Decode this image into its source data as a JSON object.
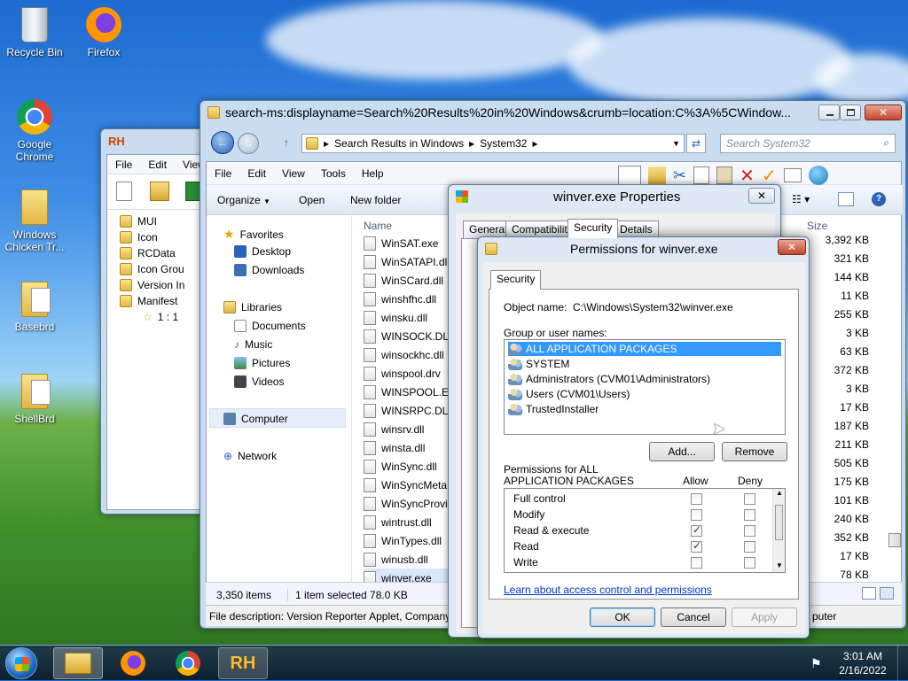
{
  "desktop": {
    "icons": [
      {
        "label": "Recycle Bin"
      },
      {
        "label": "Firefox"
      },
      {
        "label": "Google Chrome"
      },
      {
        "label": "Windows Chicken Tr..."
      },
      {
        "label": "Basebrd"
      },
      {
        "label": "ShellBrd"
      }
    ]
  },
  "rh_window": {
    "title": "RH",
    "menu": [
      "File",
      "Edit",
      "View"
    ],
    "tree": [
      "MUI",
      "Icon",
      "RCData",
      "Icon Grou",
      "Version In",
      "Manifest",
      "1 : 1"
    ]
  },
  "explorer": {
    "title": "search-ms:displayname=Search%20Results%20in%20Windows&crumb=location:C%3A%5CWindow...",
    "breadcrumb": [
      "Search Results in Windows",
      "System32"
    ],
    "search_placeholder": "Search System32",
    "menu": [
      "File",
      "Edit",
      "View",
      "Tools",
      "Help"
    ],
    "toolbar": {
      "organize": "Organize",
      "open": "Open",
      "new_folder": "New folder"
    },
    "nav": {
      "favorites": "Favorites",
      "desktop": "Desktop",
      "downloads": "Downloads",
      "libraries": "Libraries",
      "documents": "Documents",
      "music": "Music",
      "pictures": "Pictures",
      "videos": "Videos",
      "computer": "Computer",
      "network": "Network"
    },
    "columns": {
      "name": "Name",
      "size": "Size"
    },
    "files": [
      {
        "name": "WinSAT.exe",
        "size": "3,392 KB"
      },
      {
        "name": "WinSATAPI.dll",
        "size": "321 KB"
      },
      {
        "name": "WinSCard.dll",
        "size": "144 KB"
      },
      {
        "name": "winshfhc.dll",
        "size": "11 KB"
      },
      {
        "name": "winsku.dll",
        "size": "255 KB"
      },
      {
        "name": "WINSOCK.DLL",
        "size": "3 KB"
      },
      {
        "name": "winsockhc.dll",
        "size": "63 KB"
      },
      {
        "name": "winspool.drv",
        "size": "372 KB"
      },
      {
        "name": "WINSPOOL.EX",
        "size": "3 KB"
      },
      {
        "name": "WINSRPC.DLL",
        "size": "17 KB"
      },
      {
        "name": "winsrv.dll",
        "size": "187 KB"
      },
      {
        "name": "winsta.dll",
        "size": "211 KB"
      },
      {
        "name": "WinSync.dll",
        "size": "505 KB"
      },
      {
        "name": "WinSyncMeta",
        "size": "175 KB"
      },
      {
        "name": "WinSyncProvi",
        "size": "101 KB"
      },
      {
        "name": "wintrust.dll",
        "size": "240 KB"
      },
      {
        "name": "WinTypes.dll",
        "size": "352 KB"
      },
      {
        "name": "winusb.dll",
        "size": "17 KB"
      },
      {
        "name": "winver.exe",
        "size": "78 KB"
      }
    ],
    "status": {
      "count": "3,350 items",
      "selected": "1 item selected  78.0 KB"
    },
    "description": "File description: Version Reporter Applet, Company",
    "computer_label": "puter"
  },
  "properties": {
    "title": "winver.exe Properties",
    "tabs": [
      "General",
      "Compatibility",
      "Security",
      "Details"
    ]
  },
  "permissions": {
    "title": "Permissions for winver.exe",
    "tab": "Security",
    "object_label": "Object name:",
    "object_value": "C:\\Windows\\System32\\winver.exe",
    "group_label": "Group or user names:",
    "users": [
      "ALL APPLICATION PACKAGES",
      "SYSTEM",
      "Administrators (CVM01\\Administrators)",
      "Users (CVM01\\Users)",
      "TrustedInstaller"
    ],
    "add_btn": "Add...",
    "remove_btn": "Remove",
    "perm_label_1": "Permissions for ALL",
    "perm_label_2": "APPLICATION PACKAGES",
    "allow": "Allow",
    "deny": "Deny",
    "perms": [
      {
        "name": "Full control",
        "allow": false,
        "deny": false
      },
      {
        "name": "Modify",
        "allow": false,
        "deny": false
      },
      {
        "name": "Read & execute",
        "allow": true,
        "deny": false
      },
      {
        "name": "Read",
        "allow": true,
        "deny": false
      },
      {
        "name": "Write",
        "allow": false,
        "deny": false
      }
    ],
    "link": "Learn about access control and permissions",
    "ok": "OK",
    "cancel": "Cancel",
    "apply": "Apply"
  },
  "taskbar": {
    "time": "3:01 AM",
    "date": "2/16/2022",
    "rh": "RH"
  },
  "colors": {
    "selection": "#3399ff",
    "link": "#0033cc",
    "title_bar": "#c9dcf0"
  }
}
